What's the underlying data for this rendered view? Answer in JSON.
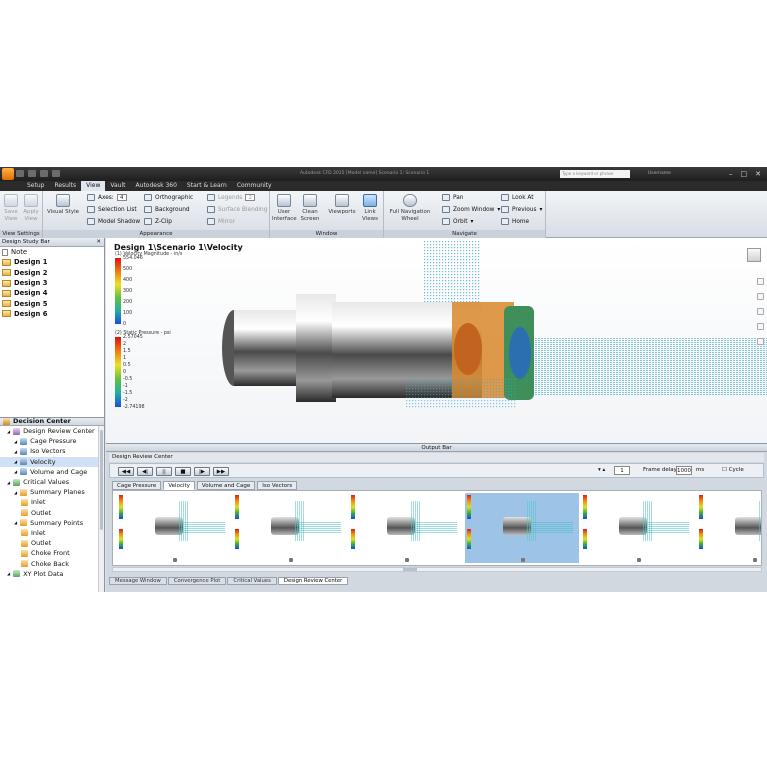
{
  "titlebar": {
    "doc_title": "Autodesk CFD 2015    [Model name] Scenario 1: Scenario 1",
    "search_placeholder": "Type a keyword or phrase",
    "user": "Username"
  },
  "tabs": [
    "Setup",
    "Results",
    "View",
    "Vault",
    "Autodesk 360",
    "Start & Learn",
    "Community"
  ],
  "active_tab": "View",
  "ribbon": {
    "view_settings": {
      "title": "View Settings",
      "save": "Save View",
      "apply": "Apply View"
    },
    "appearance": {
      "title": "Appearance",
      "visual_style": "Visual Style",
      "axes": "Axes:",
      "axes_value": "4",
      "selection_list": "Selection List",
      "model_shadow": "Model Shadow",
      "orthographic": "Orthographic",
      "background": "Background",
      "zclip": "Z-Clip",
      "legends": "Legends",
      "legends_value": "2",
      "surface_blending": "Surface Blending",
      "mirror": "Mirror"
    },
    "window": {
      "title": "Window",
      "user_interface": "User Interface",
      "clean_screen": "Clean Screen",
      "viewports": "Viewports",
      "link_views": "Link Views"
    },
    "navigate": {
      "title": "Navigate",
      "full_nav": "Full Navigation Wheel",
      "pan": "Pan",
      "zoom_window": "Zoom Window",
      "orbit": "Orbit",
      "look_at": "Look At",
      "previous": "Previous",
      "home": "Home"
    }
  },
  "design_study_bar": {
    "title": "Design Study Bar",
    "note": "Note",
    "designs": [
      "Design 1",
      "Design 2",
      "Design 3",
      "Design 4",
      "Design 5",
      "Design 6"
    ]
  },
  "decision_center": {
    "title": "Decision Center",
    "items": [
      {
        "label": "Design Review Center",
        "indent": 1,
        "icon": "p"
      },
      {
        "label": "Cage Pressure",
        "indent": 2,
        "icon": "b"
      },
      {
        "label": "Iso Vectors",
        "indent": 2,
        "icon": "b"
      },
      {
        "label": "Velocity",
        "indent": 2,
        "icon": "b",
        "selected": true
      },
      {
        "label": "Volume and Cage",
        "indent": 2,
        "icon": "b"
      },
      {
        "label": "Critical Values",
        "indent": 1,
        "icon": "g"
      },
      {
        "label": "Summary Planes",
        "indent": 2,
        "icon": "o"
      },
      {
        "label": "Inlet",
        "indent": 3,
        "icon": "o"
      },
      {
        "label": "Outlet",
        "indent": 3,
        "icon": "o"
      },
      {
        "label": "Summary Points",
        "indent": 2,
        "icon": "o"
      },
      {
        "label": "Inlet",
        "indent": 3,
        "icon": "o"
      },
      {
        "label": "Outlet",
        "indent": 3,
        "icon": "o"
      },
      {
        "label": "Choke Front",
        "indent": 3,
        "icon": "o"
      },
      {
        "label": "Choke Back",
        "indent": 3,
        "icon": "o"
      },
      {
        "label": "XY Plot Data",
        "indent": 1,
        "icon": "g"
      }
    ]
  },
  "viewport": {
    "title": "Design 1\\Scenario 1\\Velocity",
    "legend1": {
      "label": "(1) Velocity Magnitude - in/s",
      "ticks": [
        "554.046",
        "500",
        "400",
        "300",
        "200",
        "100",
        "0"
      ]
    },
    "legend2": {
      "label": "(2) Static Pressure - psi",
      "ticks": [
        "2.57045",
        "2",
        "1.5",
        "1",
        "0.5",
        "0",
        "-0.5",
        "-1",
        "-1.5",
        "-2",
        "-2.74198"
      ]
    }
  },
  "output_bar": {
    "title": "Output Bar",
    "review_title": "Design Review Center",
    "controls": [
      "◀◀",
      "◀|",
      "||",
      "■",
      "|▶",
      "▶▶"
    ],
    "index": "1",
    "frame_delay_label": "Frame delay:",
    "frame_delay": "1000",
    "ms": "ms",
    "cycle": "Cycle",
    "image_tabs": [
      "Cage Pressure",
      "Velocity",
      "Volume and Cage",
      "Iso Vectors"
    ],
    "active_image_tab": "Velocity",
    "bottom_tabs": [
      "Message Window",
      "Convergence Plot",
      "Critical Values",
      "Design Review Center"
    ],
    "active_bottom_tab": "Design Review Center"
  }
}
